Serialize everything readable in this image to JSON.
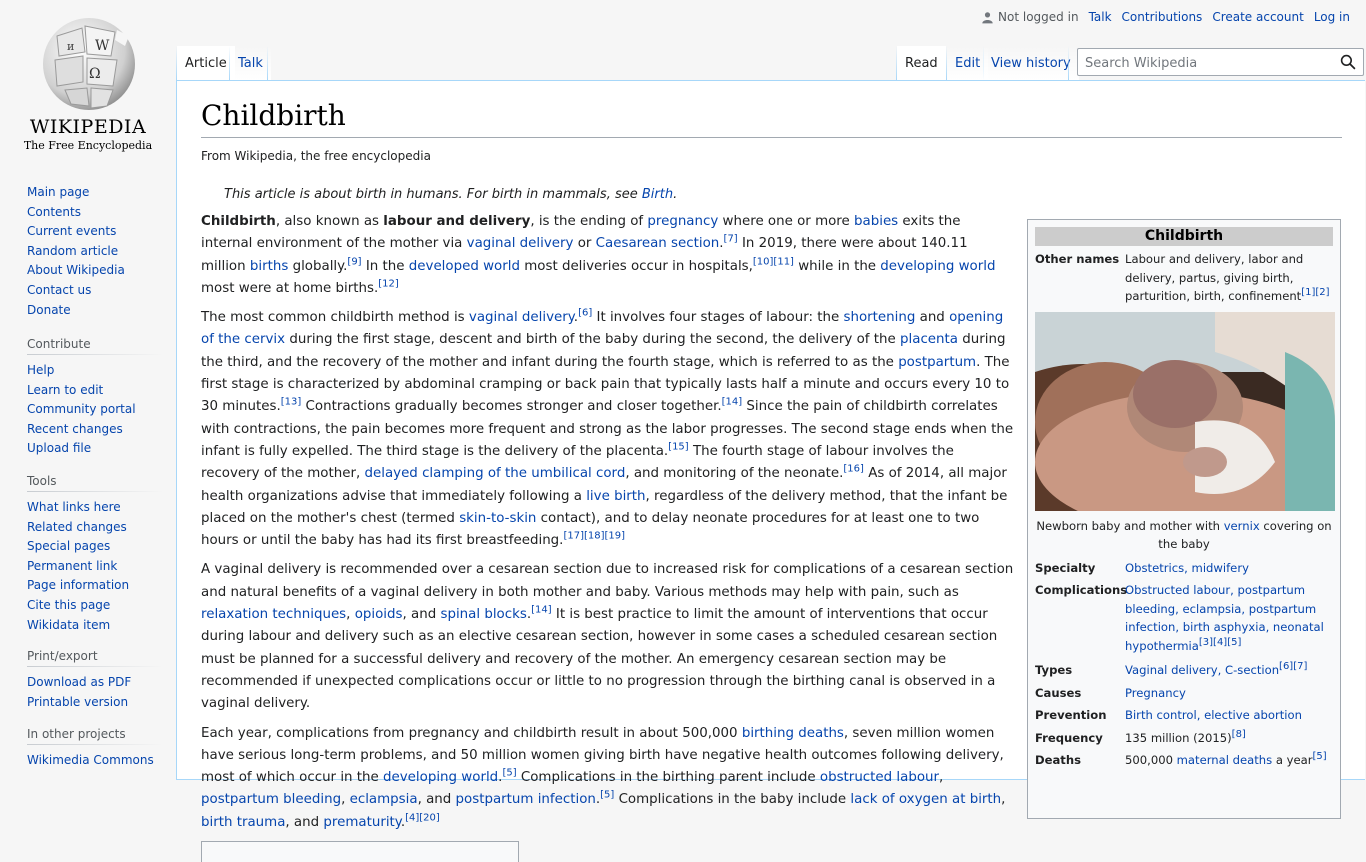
{
  "logo": {
    "wordmark": "Wikipedia",
    "tagline": "The Free Encyclopedia"
  },
  "personal": {
    "not_logged_in": "Not logged in",
    "talk": "Talk",
    "contributions": "Contributions",
    "create_account": "Create account",
    "log_in": "Log in"
  },
  "tabs": {
    "article": "Article",
    "talk": "Talk",
    "read": "Read",
    "edit": "Edit",
    "view_history": "View history"
  },
  "search": {
    "placeholder": "Search Wikipedia"
  },
  "sidebar": {
    "navigation": [
      "Main page",
      "Contents",
      "Current events",
      "Random article",
      "About Wikipedia",
      "Contact us",
      "Donate"
    ],
    "contribute": {
      "heading": "Contribute",
      "items": [
        "Help",
        "Learn to edit",
        "Community portal",
        "Recent changes",
        "Upload file"
      ]
    },
    "tools": {
      "heading": "Tools",
      "items": [
        "What links here",
        "Related changes",
        "Special pages",
        "Permanent link",
        "Page information",
        "Cite this page",
        "Wikidata item"
      ]
    },
    "print": {
      "heading": "Print/export",
      "items": [
        "Download as PDF",
        "Printable version"
      ]
    },
    "projects": {
      "heading": "In other projects",
      "items": [
        "Wikimedia Commons"
      ]
    }
  },
  "article": {
    "title": "Childbirth",
    "site_sub": "From Wikipedia, the free encyclopedia",
    "hatnote_text": "This article is about birth in humans. For birth in mammals, see ",
    "hatnote_link": "Birth",
    "hatnote_end": "."
  },
  "infobox": {
    "title": "Childbirth",
    "other_names_label": "Other names",
    "other_names": "Labour and delivery, labor and delivery, partus, giving birth, parturition, birth, confinement",
    "other_names_refs": "[1][2]",
    "caption_pre": "Newborn baby and mother with ",
    "caption_link": "vernix",
    "caption_post": " covering on the baby",
    "specialty_label": "Specialty",
    "specialty": "Obstetrics, midwifery",
    "complications_label": "Complications",
    "complications": "Obstructed labour, postpartum bleeding, eclampsia, postpartum infection, birth asphyxia, neonatal hypothermia",
    "complications_refs": "[3][4][5]",
    "types_label": "Types",
    "types": "Vaginal delivery, C-section",
    "types_refs": "[6][7]",
    "causes_label": "Causes",
    "causes": "Pregnancy",
    "prevention_label": "Prevention",
    "prevention": "Birth control, elective abortion",
    "frequency_label": "Frequency",
    "frequency": "135 million (2015)",
    "frequency_refs": "[8]",
    "deaths_label": "Deaths",
    "deaths_pre": "500,000 ",
    "deaths_link": "maternal deaths",
    "deaths_post": " a year",
    "deaths_refs": "[5]"
  },
  "colors": {
    "link": "#0645ad",
    "border": "#a7d7f9",
    "bg": "#f6f6f6"
  }
}
